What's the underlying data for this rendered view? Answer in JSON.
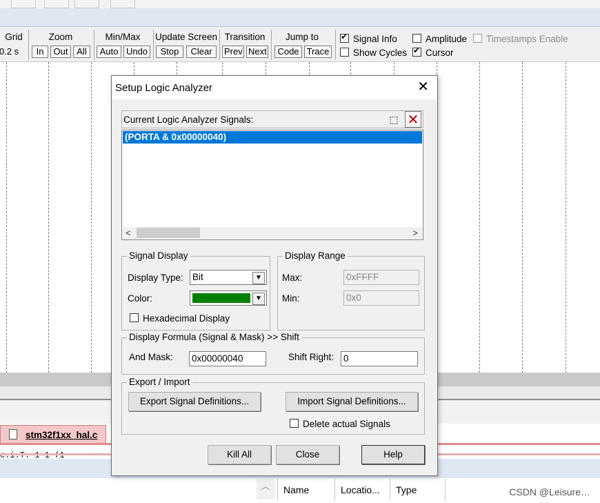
{
  "toolbar": {
    "groups": [
      {
        "title": "Grid",
        "buttons": []
      },
      {
        "title": "Zoom",
        "buttons": [
          "In",
          "Out",
          "All"
        ]
      },
      {
        "title": "Min/Max",
        "buttons": [
          "Auto",
          "Undo"
        ]
      },
      {
        "title": "Update Screen",
        "buttons": [
          "Stop",
          "Clear"
        ]
      },
      {
        "title": "Transition",
        "buttons": [
          "Prev",
          "Next"
        ]
      },
      {
        "title": "Jump to",
        "buttons": [
          "Code",
          "Trace"
        ]
      }
    ],
    "grid_value": "0.2 s",
    "options": {
      "signal_info": {
        "label": "Signal Info",
        "checked": true
      },
      "amplitude": {
        "label": "Amplitude",
        "checked": false
      },
      "timestamps_enable": {
        "label": "Timestamps Enable",
        "checked": false,
        "disabled": true
      },
      "show_cycles": {
        "label": "Show Cycles",
        "checked": false
      },
      "cursor": {
        "label": "Cursor",
        "checked": true
      }
    }
  },
  "editor_tab": {
    "label": "stm32f1xx_hal.c"
  },
  "code_fragment": "c.i.T. 1 1 (1",
  "bottom_pane": {
    "columns": [
      "Name",
      "Locatio...",
      "Type"
    ]
  },
  "dialog": {
    "title": "Setup Logic Analyzer",
    "close_glyph": "✕",
    "signals_label": "Current Logic Analyzer Signals:",
    "signals": [
      "(PORTA & 0x00000040)"
    ],
    "new_icon_glyph": "⬚",
    "delete_icon_glyph": "✕",
    "signal_display": {
      "legend": "Signal Display",
      "display_type_label": "Display Type:",
      "display_type_value": "Bit",
      "color_label": "Color:",
      "color_value": "#008000",
      "hex_label": "Hexadecimal Display",
      "hex_checked": false
    },
    "display_range": {
      "legend": "Display Range",
      "max_label": "Max:",
      "max_value": "0xFFFF",
      "min_label": "Min:",
      "min_value": "0x0"
    },
    "formula": {
      "legend": "Display Formula (Signal & Mask) >> Shift",
      "and_mask_label": "And Mask:",
      "and_mask_value": "0x00000040",
      "shift_right_label": "Shift Right:",
      "shift_right_value": "0"
    },
    "export_import": {
      "legend": "Export / Import",
      "export_button": "Export Signal Definitions...",
      "import_button": "Import Signal Definitions...",
      "delete_label": "Delete actual Signals",
      "delete_checked": false
    },
    "buttons": {
      "kill_all": "Kill All",
      "close": "Close",
      "help": "Help"
    }
  },
  "watermark": "CSDN @Leisure…"
}
